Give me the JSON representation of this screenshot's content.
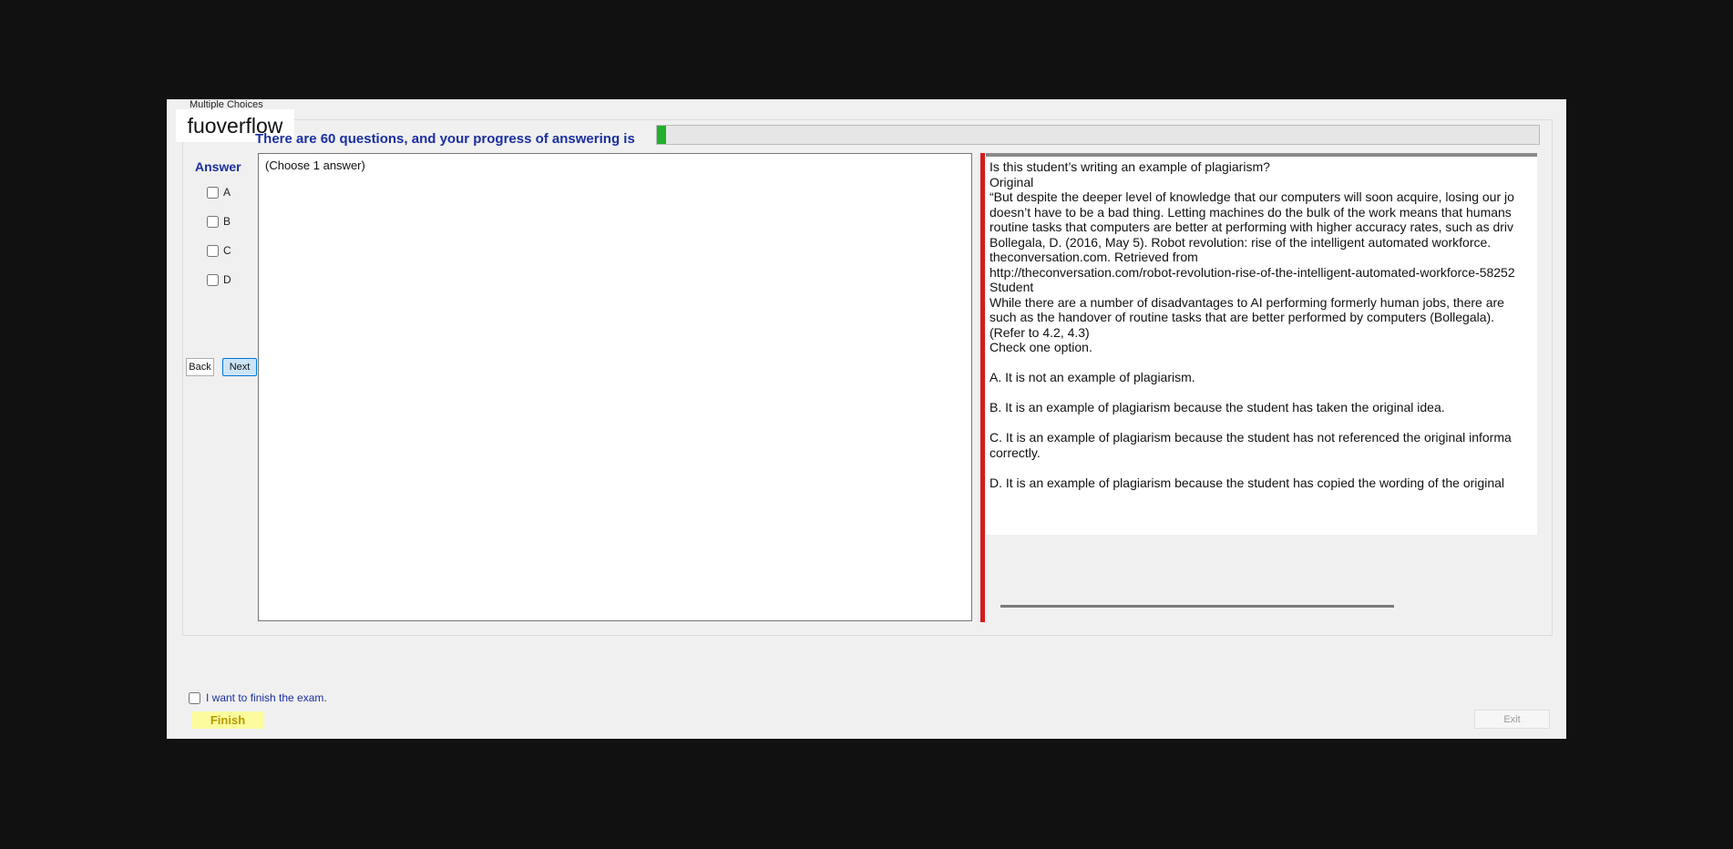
{
  "window": {
    "tab_label": "Multiple Choices",
    "brand": "fuoverflow"
  },
  "progress": {
    "label": "There are 60 questions, and your progress of answering is",
    "fraction": 0.01
  },
  "answer_panel": {
    "title": "Answer",
    "options": [
      "A",
      "B",
      "C",
      "D"
    ],
    "back_label": "Back",
    "next_label": "Next"
  },
  "answer_box": {
    "hint": "(Choose 1 answer)"
  },
  "question": {
    "lines": [
      "Is this student’s writing an example of plagiarism?",
      "Original",
      "“But despite the deeper level of knowledge that our computers will soon acquire, losing our jo",
      "doesn’t have to be a bad thing. Letting machines do the bulk of the work means that humans",
      "routine tasks that computers are better at performing with higher accuracy rates, such as driv",
      "Bollegala, D. (2016, May 5). Robot revolution: rise of the intelligent automated workforce.",
      "theconversation.com. Retrieved from",
      "http://theconversation.com/robot-revolution-rise-of-the-intelligent-automated-workforce-58252",
      "Student",
      "While there are a number of disadvantages to AI performing formerly human jobs, there are",
      "such as the handover of routine tasks that are better performed by computers (Bollegala).",
      "(Refer to 4.2, 4.3)",
      "Check one option.",
      "",
      "A.  It is not an example of plagiarism.",
      "",
      "B.  It is an example of plagiarism because the student has taken the original idea.",
      "",
      "C.  It is an example of plagiarism because the student has not referenced the original informa",
      "correctly.",
      "",
      "D.  It is an example of plagiarism because the student has copied the wording of the original"
    ]
  },
  "footer": {
    "finish_check_label": "I want to finish the exam.",
    "finish_label": "Finish",
    "exit_label": "Exit"
  }
}
